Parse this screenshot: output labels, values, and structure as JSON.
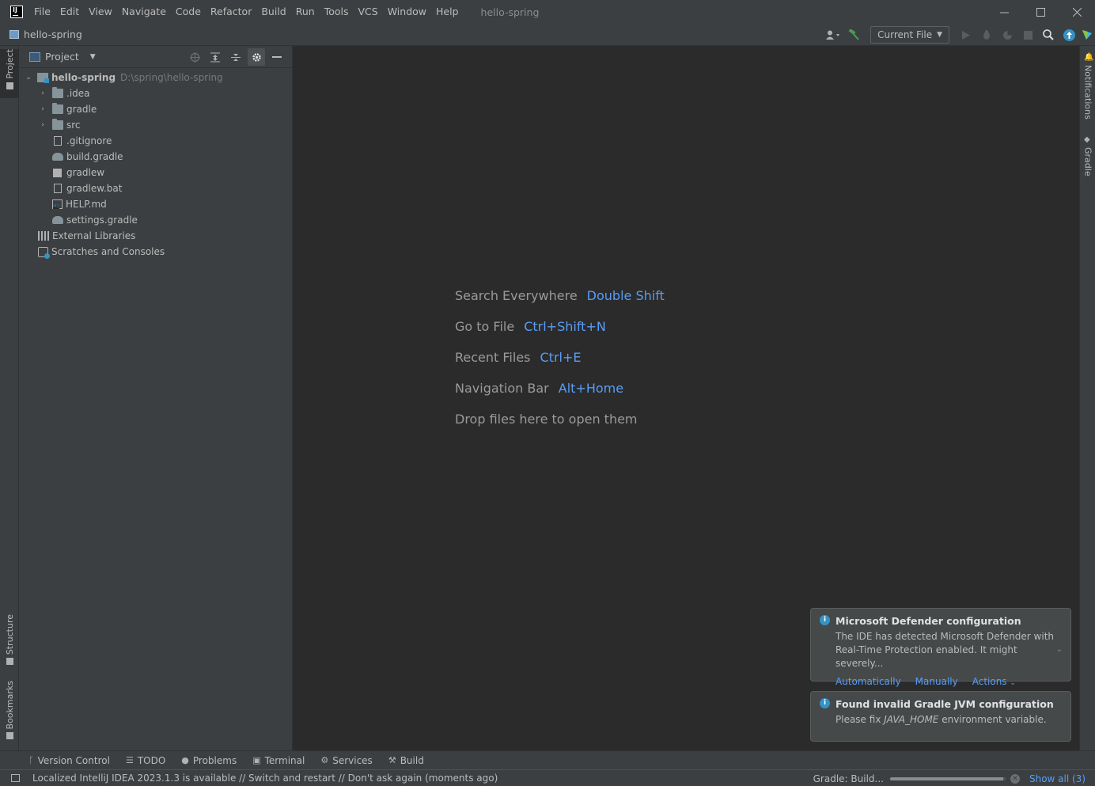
{
  "titlebar": {
    "menu": [
      "File",
      "Edit",
      "View",
      "Navigate",
      "Code",
      "Refactor",
      "Build",
      "Run",
      "Tools",
      "VCS",
      "Window",
      "Help"
    ],
    "title": "hello-spring"
  },
  "navbar": {
    "project": "hello-spring",
    "run_config": "Current File"
  },
  "left_strip": {
    "project": "Project",
    "structure": "Structure",
    "bookmarks": "Bookmarks"
  },
  "right_strip": {
    "notifications": "Notifications",
    "gradle": "Gradle"
  },
  "project_panel": {
    "title": "Project",
    "root": {
      "name": "hello-spring",
      "path": "D:\\spring\\hello-spring"
    },
    "items": [
      {
        "label": ".idea"
      },
      {
        "label": "gradle"
      },
      {
        "label": "src"
      },
      {
        "label": ".gitignore"
      },
      {
        "label": "build.gradle"
      },
      {
        "label": "gradlew"
      },
      {
        "label": "gradlew.bat"
      },
      {
        "label": "HELP.md"
      },
      {
        "label": "settings.gradle"
      },
      {
        "label": "External Libraries"
      },
      {
        "label": "Scratches and Consoles"
      }
    ]
  },
  "editor_hints": [
    {
      "label": "Search Everywhere",
      "key": "Double Shift"
    },
    {
      "label": "Go to File",
      "key": "Ctrl+Shift+N"
    },
    {
      "label": "Recent Files",
      "key": "Ctrl+E"
    },
    {
      "label": "Navigation Bar",
      "key": "Alt+Home"
    },
    {
      "label": "Drop files here to open them",
      "key": ""
    }
  ],
  "notifications": [
    {
      "title": "Microsoft Defender configuration",
      "body_line1": "The IDE has detected Microsoft Defender with",
      "body_line2": "Real-Time Protection enabled. It might severely...",
      "actions": [
        "Automatically",
        "Manually",
        "Actions"
      ]
    },
    {
      "title": "Found invalid Gradle JVM configuration",
      "body_prefix": "Please fix ",
      "body_em": "JAVA_HOME",
      "body_suffix": " environment variable."
    }
  ],
  "tool_windows": [
    "Version Control",
    "TODO",
    "Problems",
    "Terminal",
    "Services",
    "Build"
  ],
  "statusbar": {
    "message": "Localized IntelliJ IDEA 2023.1.3 is available // Switch and restart // Don't ask again (moments ago)",
    "gradle_task": "Gradle: Build...",
    "progress": 0.98,
    "show_all": "Show all (3)"
  },
  "colors": {
    "accent_link": "#589df6",
    "info_icon": "#3592c4",
    "background": "#2b2b2b",
    "panel": "#3c3f41"
  }
}
